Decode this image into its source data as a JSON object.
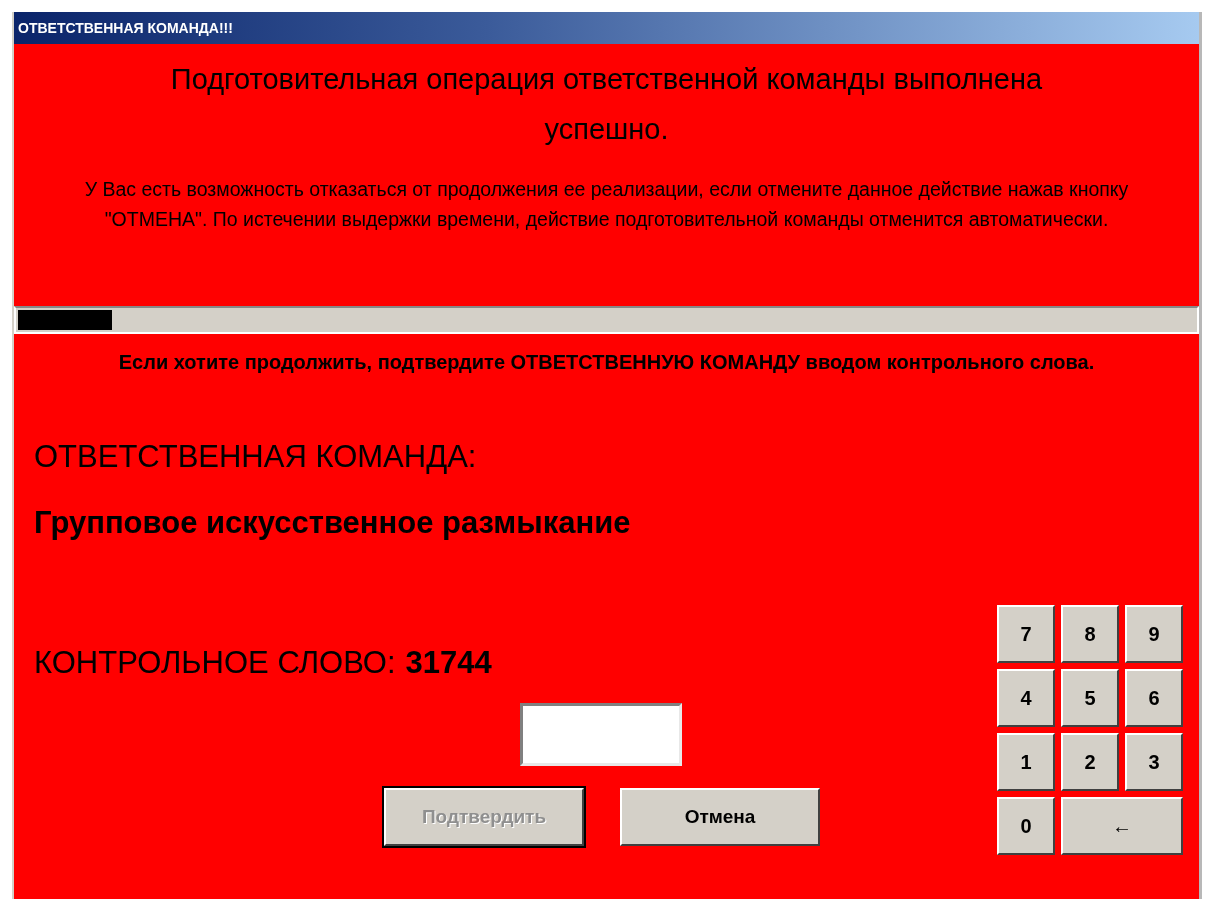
{
  "window": {
    "title": "ОТВЕТСТВЕННАЯ КОМАНДА!!!"
  },
  "header": {
    "heading": "Подготовительная операция ответственной команды выполнена успешно.",
    "message": "У Вас есть возможность отказаться от продолжения ее реализации, если отмените данное действие нажав кнопку \"ОТМЕНА\". По истечении выдержки времени, действие подготовительной команды отменится автоматически."
  },
  "progress": {
    "level": 0.08
  },
  "notice": "Если хотите продолжить, подтвердите ОТВЕТСТВЕННУЮ КОМАНДУ вводом контрольного слова.",
  "command": {
    "label": "ОТВЕТСТВЕННАЯ КОМАНДА:",
    "name": "Групповое искусственное размыкание"
  },
  "control_word": {
    "label": "КОНТРОЛЬНОЕ СЛОВО:",
    "value": "31744"
  },
  "buttons": [
    {
      "label": "Подтвердить",
      "disabled": true
    },
    {
      "label": "Отмена",
      "disabled": false
    }
  ],
  "keypad": [
    {
      "label": "7",
      "kind": "digit"
    },
    {
      "label": "8",
      "kind": "digit"
    },
    {
      "label": "9",
      "kind": "digit"
    },
    {
      "label": "4",
      "kind": "digit"
    },
    {
      "label": "5",
      "kind": "digit"
    },
    {
      "label": "6",
      "kind": "digit"
    },
    {
      "label": "1",
      "kind": "digit"
    },
    {
      "label": "2",
      "kind": "digit"
    },
    {
      "label": "3",
      "kind": "digit"
    },
    {
      "label": "0",
      "kind": "digit"
    },
    {
      "label": "←",
      "kind": "backspace"
    }
  ]
}
